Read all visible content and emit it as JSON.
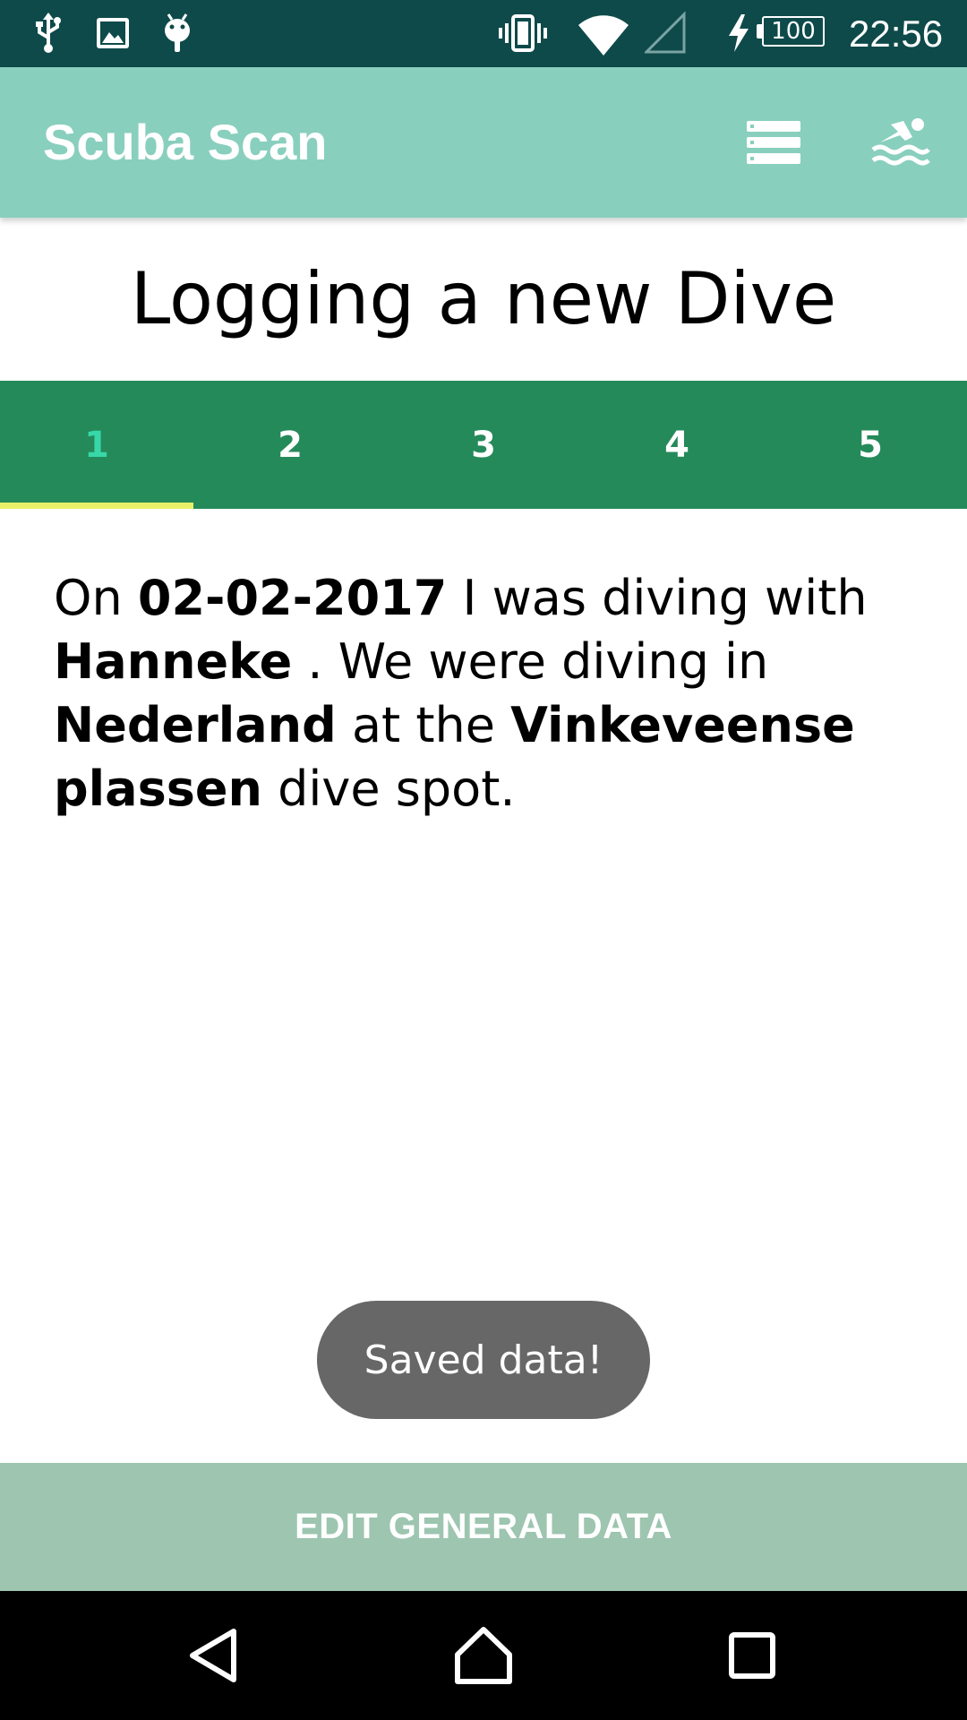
{
  "status_bar": {
    "left_icons": [
      "usb-icon",
      "image-icon",
      "android-debug-icon"
    ],
    "right_icons": [
      "vibrate-icon",
      "wifi-icon",
      "cell-signal-icon",
      "charging-icon",
      "battery-icon"
    ],
    "battery_level": "100",
    "time": "22:56"
  },
  "app_bar": {
    "title": "Scuba Scan",
    "actions": [
      "list-icon",
      "swimmer-icon"
    ],
    "color": "#89cfbe"
  },
  "page": {
    "title": "Logging a new Dive"
  },
  "tabs": {
    "items": [
      "1",
      "2",
      "3",
      "4",
      "5"
    ],
    "active_index": 0,
    "color": "#258a5a",
    "indicator_color": "#e8f06a"
  },
  "summary": {
    "t1": "On ",
    "date": "02-02-2017",
    "t2": " I was diving with ",
    "buddy": "Hanneke",
    "t3": " . We were diving in ",
    "country": "Nederland",
    "t4": " at the ",
    "spot": "Vinkeveense plassen",
    "t5": " dive spot."
  },
  "toast": {
    "message": "Saved data!"
  },
  "bottom_button": {
    "label": "EDIT GENERAL DATA",
    "color": "#9dc5b0"
  },
  "nav_bar": {
    "buttons": [
      "back-icon",
      "home-icon",
      "recents-icon"
    ]
  }
}
